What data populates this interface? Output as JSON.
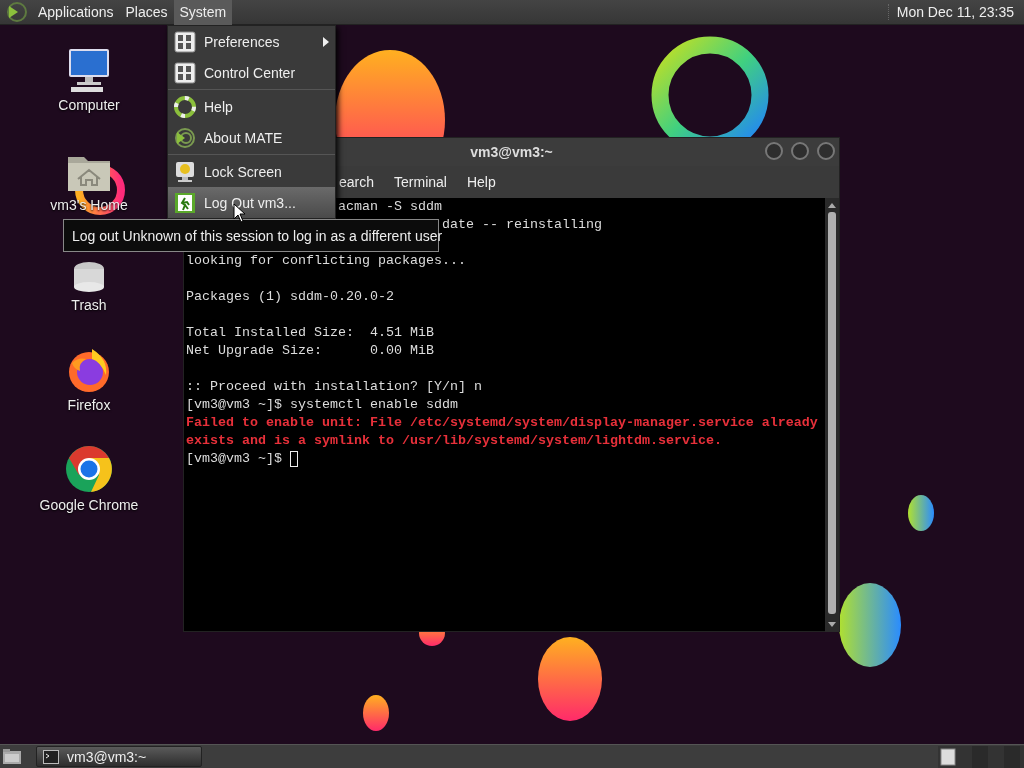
{
  "top_panel": {
    "menus": [
      {
        "label": "Applications",
        "selected": false
      },
      {
        "label": "Places",
        "selected": false
      },
      {
        "label": "System",
        "selected": true
      }
    ],
    "clock": "Mon Dec 11, 23:35"
  },
  "desktop_icons": [
    {
      "label": "Computer",
      "kind": "computer"
    },
    {
      "label": "vm3's Home",
      "kind": "home"
    },
    {
      "label": "Trash",
      "kind": "trash"
    },
    {
      "label": "Firefox",
      "kind": "firefox"
    },
    {
      "label": "Google Chrome",
      "kind": "chrome"
    }
  ],
  "system_menu": {
    "groups": [
      {
        "items": [
          {
            "label": "Preferences",
            "kind": "preferences",
            "has_submenu": true,
            "selected": false
          },
          {
            "label": "Control Center",
            "kind": "control-center",
            "has_submenu": false,
            "selected": false
          }
        ]
      },
      {
        "items": [
          {
            "label": "Help",
            "kind": "help",
            "has_submenu": false,
            "selected": false
          },
          {
            "label": "About MATE",
            "kind": "about",
            "has_submenu": false,
            "selected": false
          }
        ]
      },
      {
        "items": [
          {
            "label": "Lock Screen",
            "kind": "lock",
            "has_submenu": false,
            "selected": false
          },
          {
            "label": "Log Out vm3...",
            "kind": "logout",
            "has_submenu": false,
            "selected": true
          }
        ]
      }
    ]
  },
  "tooltip": "Log out Unknown of this session to log in as a different user",
  "terminal": {
    "title": "vm3@vm3:~",
    "menus": [
      "earch",
      "Terminal",
      "Help"
    ],
    "lines": [
      {
        "kind": "text",
        "text": "acman -S sddm"
      },
      {
        "kind": "text",
        "text": "date -- reinstalling"
      },
      {
        "kind": "blank"
      },
      {
        "kind": "text",
        "text": "looking for conflicting packages..."
      },
      {
        "kind": "blank"
      },
      {
        "kind": "text",
        "text": "Packages (1) sddm-0.20.0-2"
      },
      {
        "kind": "blank"
      },
      {
        "kind": "text",
        "text": "Total Installed Size:  4.51 MiB"
      },
      {
        "kind": "text",
        "text": "Net Upgrade Size:      0.00 MiB"
      },
      {
        "kind": "blank"
      },
      {
        "kind": "text",
        "text": ":: Proceed with installation? [Y/n] n"
      },
      {
        "kind": "text",
        "text": "[vm3@vm3 ~]$ systemctl enable sddm"
      },
      {
        "kind": "error",
        "text": "Failed to enable unit: File /etc/systemd/system/display-manager.service already"
      },
      {
        "kind": "error",
        "text": "exists and is a symlink to /usr/lib/systemd/system/lightdm.service."
      },
      {
        "kind": "text",
        "text": "[vm3@vm3 ~]$ "
      }
    ],
    "cursor": true
  },
  "bottom_panel": {
    "tasks": [
      {
        "label": "vm3@vm3:~"
      }
    ]
  }
}
